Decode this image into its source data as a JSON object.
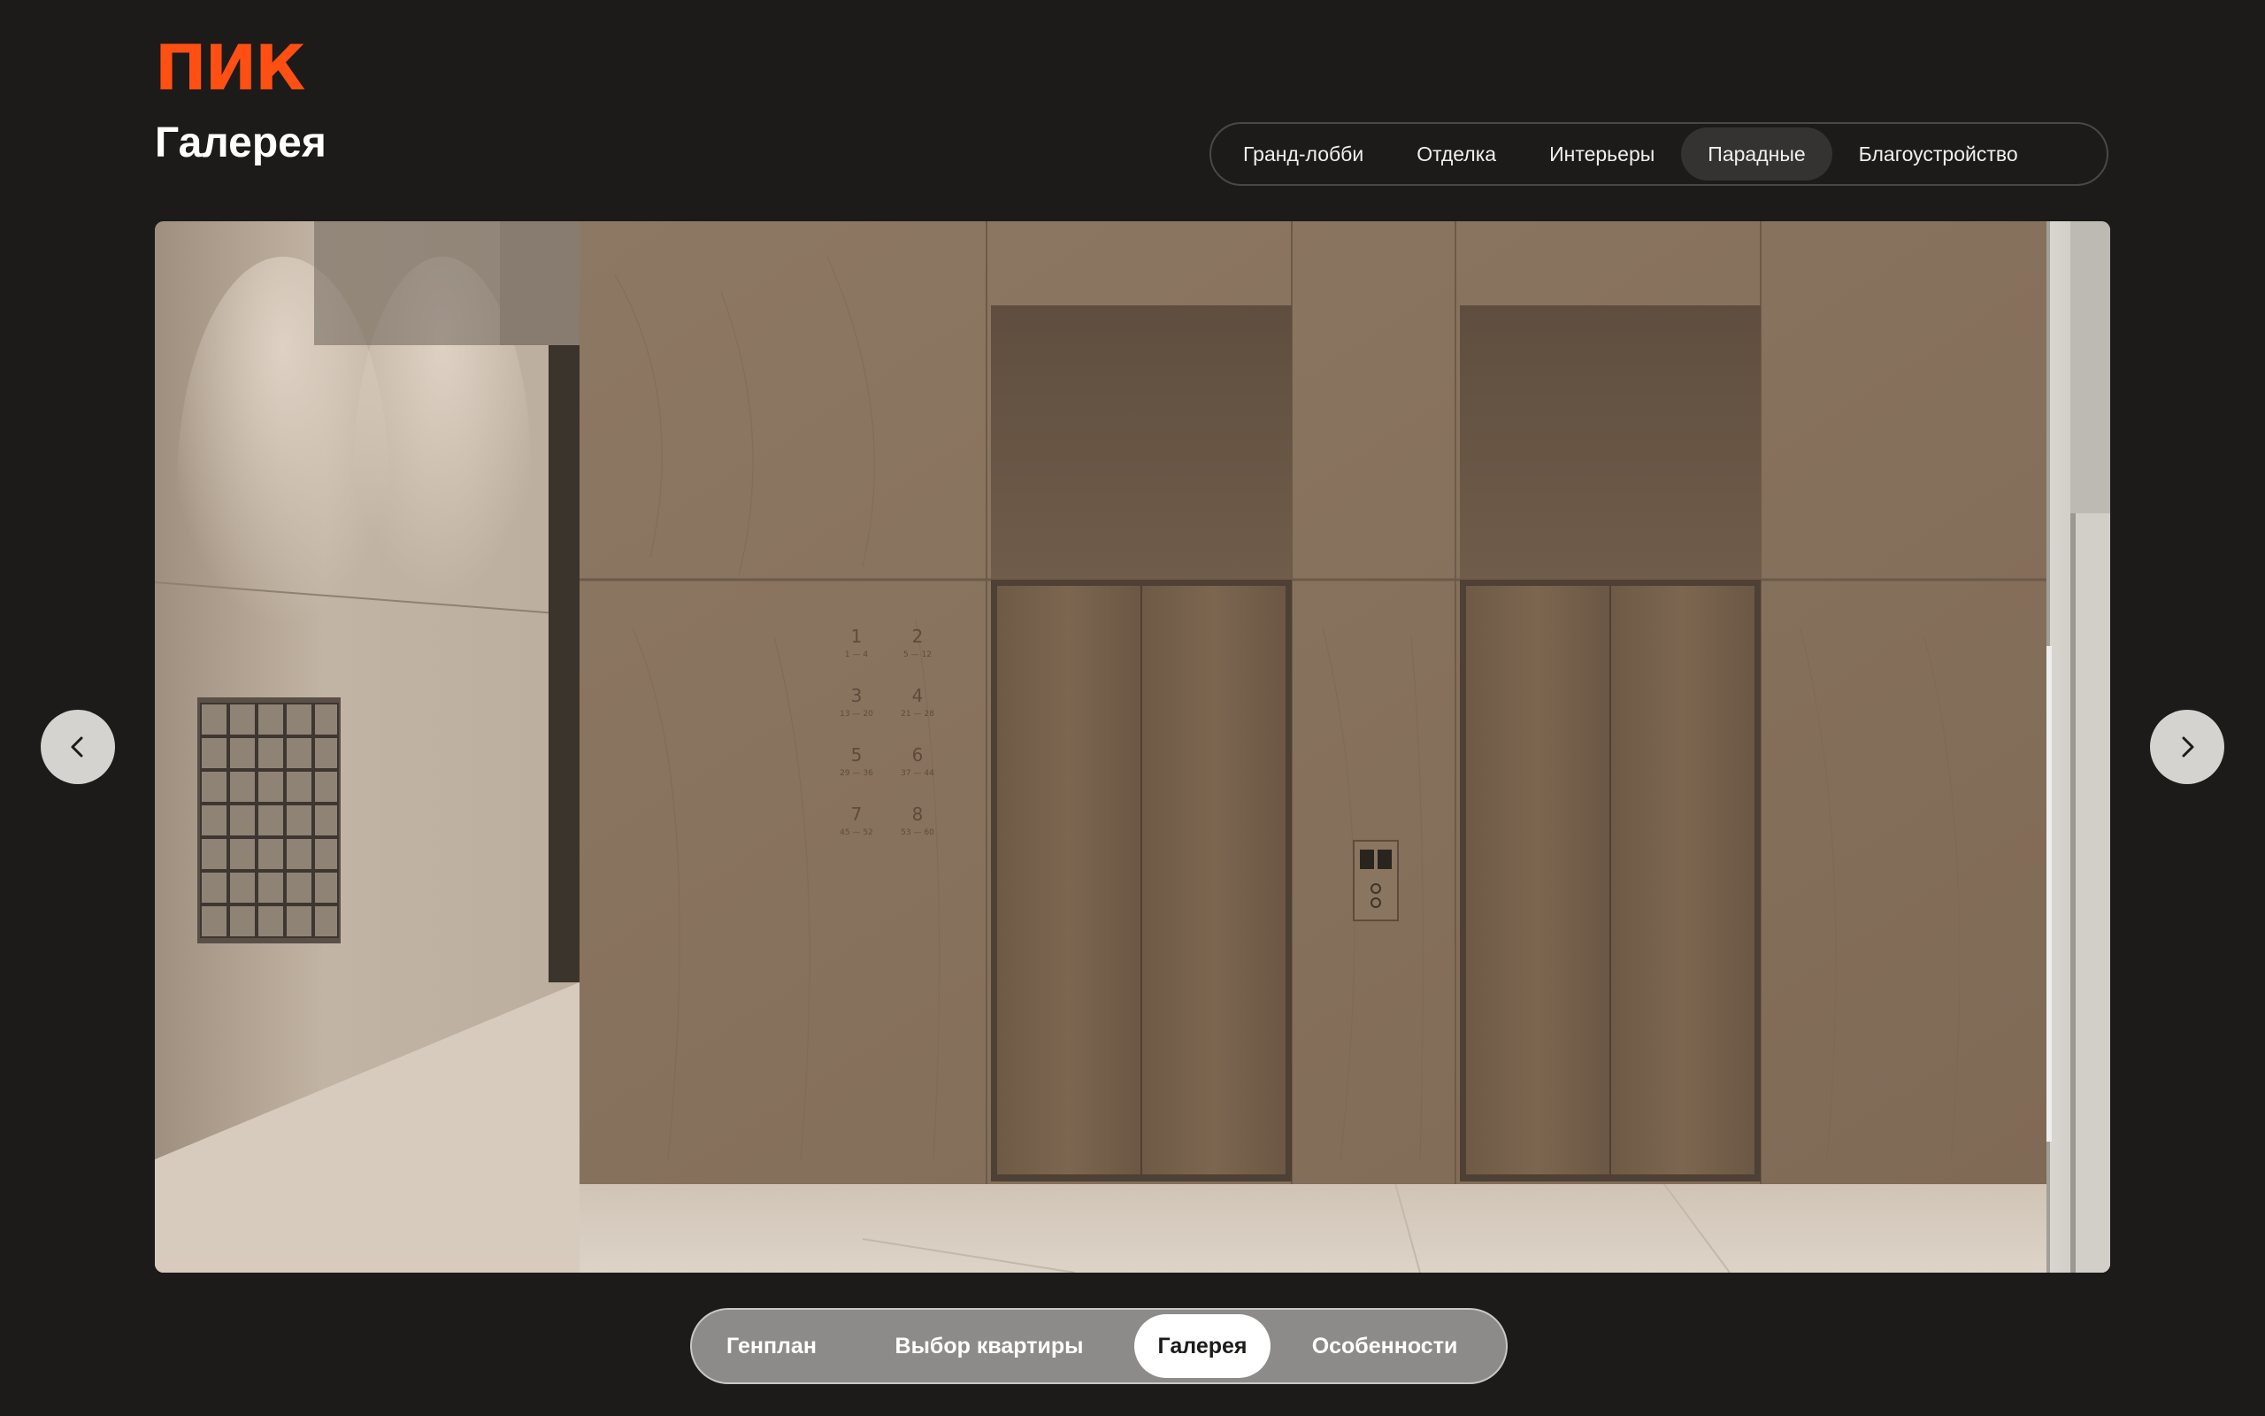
{
  "brand": {
    "logo_text": "ПИК",
    "accent_color": "#ff4f12"
  },
  "page": {
    "title": "Галерея"
  },
  "filter_tabs": [
    {
      "label": "Гранд-лобби",
      "active": false
    },
    {
      "label": "Отделка",
      "active": false
    },
    {
      "label": "Интерьеры",
      "active": false
    },
    {
      "label": "Парадные",
      "active": true
    },
    {
      "label": "Благоустройство",
      "active": false
    }
  ],
  "slider": {
    "prev_icon": "chevron-left-icon",
    "next_icon": "chevron-right-icon",
    "image": {
      "wall_numbers": [
        {
          "num": "1",
          "range": "1 — 4"
        },
        {
          "num": "2",
          "range": "5 — 12"
        },
        {
          "num": "3",
          "range": "13 — 20"
        },
        {
          "num": "4",
          "range": "21 — 28"
        },
        {
          "num": "5",
          "range": "29 — 36"
        },
        {
          "num": "6",
          "range": "37 — 44"
        },
        {
          "num": "7",
          "range": "45 — 52"
        },
        {
          "num": "8",
          "range": "53 — 60"
        }
      ]
    }
  },
  "bottom_nav": [
    {
      "label": "Генплан",
      "active": false
    },
    {
      "label": "Выбор квартиры",
      "active": false
    },
    {
      "label": "Галерея",
      "active": true
    },
    {
      "label": "Особенности",
      "active": false
    }
  ]
}
